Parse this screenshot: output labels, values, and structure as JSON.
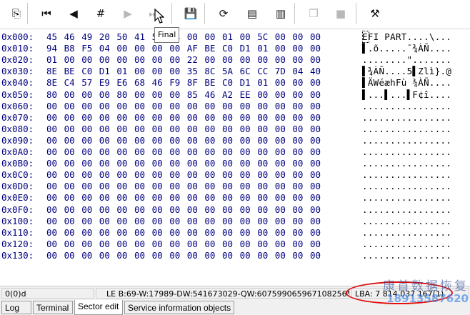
{
  "toolbar": {
    "buttons": [
      {
        "icon": "sector-edit-icon",
        "glyph": "⎘",
        "enabled": true
      },
      {
        "icon": "first-sector-icon",
        "glyph": "⏮",
        "enabled": true
      },
      {
        "icon": "previous-sector-icon",
        "glyph": "◀",
        "enabled": true
      },
      {
        "icon": "goto-sector-icon",
        "glyph": "#",
        "enabled": true
      },
      {
        "icon": "next-sector-icon",
        "glyph": "▶",
        "enabled": false
      },
      {
        "icon": "last-sector-icon",
        "glyph": "⏭",
        "enabled": false
      },
      {
        "icon": "save-disk-icon",
        "glyph": "💾",
        "enabled": false
      },
      {
        "icon": "refresh-icon",
        "glyph": "⟳",
        "enabled": true
      },
      {
        "icon": "load-file-icon",
        "glyph": "▤",
        "enabled": true
      },
      {
        "icon": "save-file-icon",
        "glyph": "▥",
        "enabled": true
      },
      {
        "icon": "copy-icon",
        "glyph": "❐",
        "enabled": false
      },
      {
        "icon": "paste-icon",
        "glyph": "■",
        "enabled": false
      },
      {
        "icon": "tools-icon",
        "glyph": "⚒",
        "enabled": true
      }
    ],
    "tooltip": "Final"
  },
  "hex_rows": [
    {
      "offset": "0x000:",
      "bytes": [
        "45",
        "46",
        "49",
        "20",
        "50",
        "41",
        "52",
        "54",
        "00",
        "00",
        "01",
        "00",
        "5C",
        "00",
        "00",
        "00"
      ],
      "ascii": "EFI PART....\\..."
    },
    {
      "offset": "0x010:",
      "bytes": [
        "94",
        "B8",
        "F5",
        "04",
        "00",
        "00",
        "00",
        "00",
        "AF",
        "BE",
        "C0",
        "D1",
        "01",
        "00",
        "00",
        "00"
      ],
      "ascii": "▌.õ.....¯¾ÀÑ...."
    },
    {
      "offset": "0x020:",
      "bytes": [
        "01",
        "00",
        "00",
        "00",
        "00",
        "00",
        "00",
        "00",
        "22",
        "00",
        "00",
        "00",
        "00",
        "00",
        "00",
        "00"
      ],
      "ascii": "........\"......."
    },
    {
      "offset": "0x030:",
      "bytes": [
        "8E",
        "BE",
        "C0",
        "D1",
        "01",
        "00",
        "00",
        "00",
        "35",
        "8C",
        "5A",
        "6C",
        "CC",
        "7D",
        "04",
        "40"
      ],
      "ascii": "▌¾ÀÑ....5▌Zlì}.@"
    },
    {
      "offset": "0x040:",
      "bytes": [
        "8E",
        "C4",
        "57",
        "E9",
        "E6",
        "68",
        "46",
        "F9",
        "8F",
        "BE",
        "C0",
        "D1",
        "01",
        "00",
        "00",
        "00"
      ],
      "ascii": "▌ÄWéæhFù ¾ÀÑ...."
    },
    {
      "offset": "0x050:",
      "bytes": [
        "80",
        "00",
        "00",
        "00",
        "80",
        "00",
        "00",
        "00",
        "85",
        "46",
        "A2",
        "EE",
        "00",
        "00",
        "00",
        "00"
      ],
      "ascii": "▌...▌...▌F¢î...."
    },
    {
      "offset": "0x060:",
      "bytes": [
        "00",
        "00",
        "00",
        "00",
        "00",
        "00",
        "00",
        "00",
        "00",
        "00",
        "00",
        "00",
        "00",
        "00",
        "00",
        "00"
      ],
      "ascii": "................"
    },
    {
      "offset": "0x070:",
      "bytes": [
        "00",
        "00",
        "00",
        "00",
        "00",
        "00",
        "00",
        "00",
        "00",
        "00",
        "00",
        "00",
        "00",
        "00",
        "00",
        "00"
      ],
      "ascii": "................"
    },
    {
      "offset": "0x080:",
      "bytes": [
        "00",
        "00",
        "00",
        "00",
        "00",
        "00",
        "00",
        "00",
        "00",
        "00",
        "00",
        "00",
        "00",
        "00",
        "00",
        "00"
      ],
      "ascii": "................"
    },
    {
      "offset": "0x090:",
      "bytes": [
        "00",
        "00",
        "00",
        "00",
        "00",
        "00",
        "00",
        "00",
        "00",
        "00",
        "00",
        "00",
        "00",
        "00",
        "00",
        "00"
      ],
      "ascii": "................"
    },
    {
      "offset": "0x0A0:",
      "bytes": [
        "00",
        "00",
        "00",
        "00",
        "00",
        "00",
        "00",
        "00",
        "00",
        "00",
        "00",
        "00",
        "00",
        "00",
        "00",
        "00"
      ],
      "ascii": "................"
    },
    {
      "offset": "0x0B0:",
      "bytes": [
        "00",
        "00",
        "00",
        "00",
        "00",
        "00",
        "00",
        "00",
        "00",
        "00",
        "00",
        "00",
        "00",
        "00",
        "00",
        "00"
      ],
      "ascii": "................"
    },
    {
      "offset": "0x0C0:",
      "bytes": [
        "00",
        "00",
        "00",
        "00",
        "00",
        "00",
        "00",
        "00",
        "00",
        "00",
        "00",
        "00",
        "00",
        "00",
        "00",
        "00"
      ],
      "ascii": "................"
    },
    {
      "offset": "0x0D0:",
      "bytes": [
        "00",
        "00",
        "00",
        "00",
        "00",
        "00",
        "00",
        "00",
        "00",
        "00",
        "00",
        "00",
        "00",
        "00",
        "00",
        "00"
      ],
      "ascii": "................"
    },
    {
      "offset": "0x0E0:",
      "bytes": [
        "00",
        "00",
        "00",
        "00",
        "00",
        "00",
        "00",
        "00",
        "00",
        "00",
        "00",
        "00",
        "00",
        "00",
        "00",
        "00"
      ],
      "ascii": "................"
    },
    {
      "offset": "0x0F0:",
      "bytes": [
        "00",
        "00",
        "00",
        "00",
        "00",
        "00",
        "00",
        "00",
        "00",
        "00",
        "00",
        "00",
        "00",
        "00",
        "00",
        "00"
      ],
      "ascii": "................"
    },
    {
      "offset": "0x100:",
      "bytes": [
        "00",
        "00",
        "00",
        "00",
        "00",
        "00",
        "00",
        "00",
        "00",
        "00",
        "00",
        "00",
        "00",
        "00",
        "00",
        "00"
      ],
      "ascii": "................"
    },
    {
      "offset": "0x110:",
      "bytes": [
        "00",
        "00",
        "00",
        "00",
        "00",
        "00",
        "00",
        "00",
        "00",
        "00",
        "00",
        "00",
        "00",
        "00",
        "00",
        "00"
      ],
      "ascii": "................"
    },
    {
      "offset": "0x120:",
      "bytes": [
        "00",
        "00",
        "00",
        "00",
        "00",
        "00",
        "00",
        "00",
        "00",
        "00",
        "00",
        "00",
        "00",
        "00",
        "00",
        "00"
      ],
      "ascii": "................"
    },
    {
      "offset": "0x130:",
      "bytes": [
        "00",
        "00",
        "00",
        "00",
        "00",
        "00",
        "00",
        "00",
        "00",
        "00",
        "00",
        "00",
        "00",
        "00",
        "00",
        "00"
      ],
      "ascii": "................"
    }
  ],
  "status_bar": {
    "position": "0(0)d",
    "values": "LE B:69-W:17989-DW:541673029-QW:6075990659671082565",
    "lba": "LBA: 7 814 037 167(1)"
  },
  "tabs": [
    "Log",
    "Terminal",
    "Sector edit",
    "Service information objects"
  ],
  "active_tab": "Sector edit",
  "watermark": {
    "title": "康首数据恢复",
    "phone": "18913587620"
  },
  "colors": {
    "hex_text": "#000080",
    "ascii_text": "#000000",
    "annotation_circle": "#e01010"
  }
}
